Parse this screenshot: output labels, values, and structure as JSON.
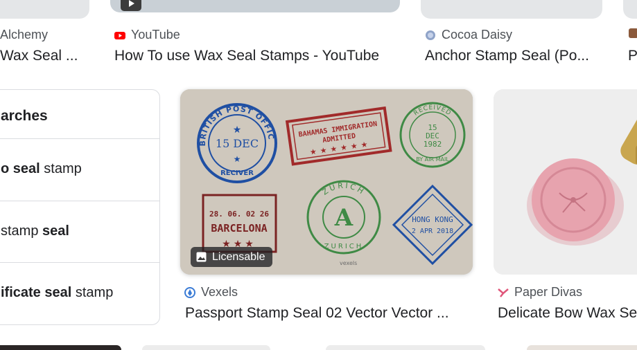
{
  "top_row": [
    {
      "source": "Alchemy",
      "title": "Wax Seal ..."
    },
    {
      "source": "YouTube",
      "title": "How To use Wax Seal Stamps - YouTube"
    },
    {
      "source": "Cocoa Daisy",
      "title": "Anchor Stamp Seal (Po..."
    },
    {
      "source": "",
      "title": "P"
    }
  ],
  "related_panel": {
    "heading": "arches",
    "items": [
      {
        "bold": "o seal",
        "rest": " stamp"
      },
      {
        "pre": "stamp ",
        "bold": "seal"
      },
      {
        "bold": "ificate seal",
        "rest": " stamp"
      }
    ]
  },
  "main_card": {
    "badge": "Licensable",
    "source": "Vexels",
    "title": "Passport Stamp Seal 02 Vector Vector ...",
    "stamps": {
      "british_ring": "BRITISH POST OFFICE",
      "british_date": "15 DEC",
      "british_bottom": "RECIVER",
      "bahamas_line1": "BAHAMAS IMMIGRATION",
      "bahamas_line2": "ADMITTED",
      "received_top": "RECEIVED",
      "received_date1": "15",
      "received_date2": "DEC",
      "received_date3": "1982",
      "received_bottom": "BY AIR MAIL",
      "barcelona_date": "28. 06. 02  26",
      "barcelona_city": "BARCELONA",
      "zurich_top": "ZURICH",
      "zurich_letter": "A",
      "zurich_bottom": "ZURICH",
      "hongkong_city": "HONG KONG",
      "hongkong_date": "2 APR 2018",
      "watermark": "vexels"
    }
  },
  "right_card": {
    "source": "Paper Divas",
    "title": "Delicate Bow Wax Se"
  },
  "colors": {
    "youtube_red": "#ff0000",
    "vexels_blue": "#3a7bd5",
    "paper_divas_pink": "#e0567a",
    "stamp_blue": "#1f4fa3",
    "stamp_red": "#a12a2a",
    "stamp_green": "#3f8a45",
    "wax_pink": "#e7a3ae"
  }
}
